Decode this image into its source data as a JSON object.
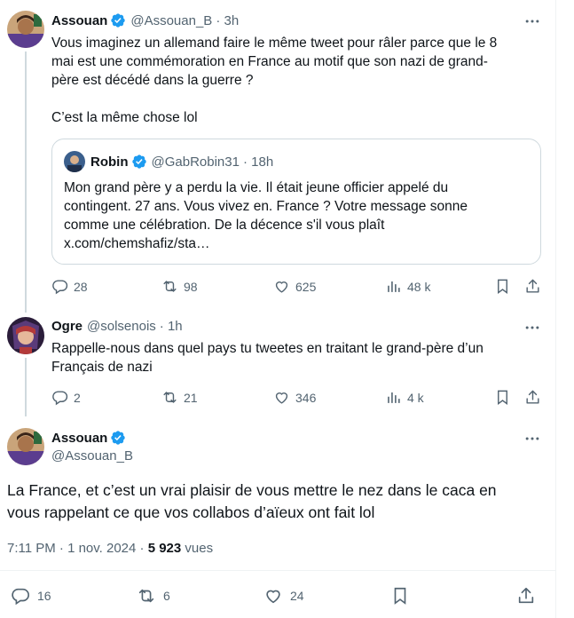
{
  "colors": {
    "verified": "#1d9bf0",
    "muted": "#536471",
    "text": "#0f1419",
    "border": "#cfd9de"
  },
  "tweet1": {
    "name": "Assouan",
    "handle": "@Assouan_B",
    "time": "· 3h",
    "lines": [
      "Vous imaginez un allemand faire le même tweet pour râler parce que le 8",
      "mai est une commémoration en France au motif que son nazi de grand-",
      "père est décédé dans la guerre ?",
      "",
      "C’est la même chose lol"
    ],
    "quote": {
      "name": "Robin",
      "handle": "@GabRobin31",
      "time": "· 18h",
      "lines": [
        "Mon grand père y a perdu la vie. Il était jeune officier appelé du",
        "contingent. 27 ans. Vous vivez en. France ? Votre message sonne",
        "comme une célébration. De la décence s'il vous plaît",
        "x.com/chemshafiz/sta…"
      ]
    },
    "stats": {
      "replies": "28",
      "retweets": "98",
      "likes": "625",
      "views": "48 k"
    }
  },
  "tweet2": {
    "name": "Ogre",
    "handle": "@solsenois",
    "time": "· 1h",
    "lines": [
      "Rappelle-nous dans quel pays tu tweetes en traitant le grand-père d’un",
      "Français de nazi"
    ],
    "stats": {
      "replies": "2",
      "retweets": "21",
      "likes": "346",
      "views": "4 k"
    }
  },
  "main": {
    "name": "Assouan",
    "handle": "@Assouan_B",
    "lines": [
      "La France, et c’est un vrai plaisir de vous mettre le nez dans le caca en",
      "vous rappelant ce que vos collabos d’aïeux ont fait lol"
    ],
    "time": "7:11 PM · 1 nov. 2024 · ",
    "views_count": "5 923",
    "views_label": " vues",
    "stats": {
      "replies": "16",
      "retweets": "6",
      "likes": "24"
    }
  }
}
